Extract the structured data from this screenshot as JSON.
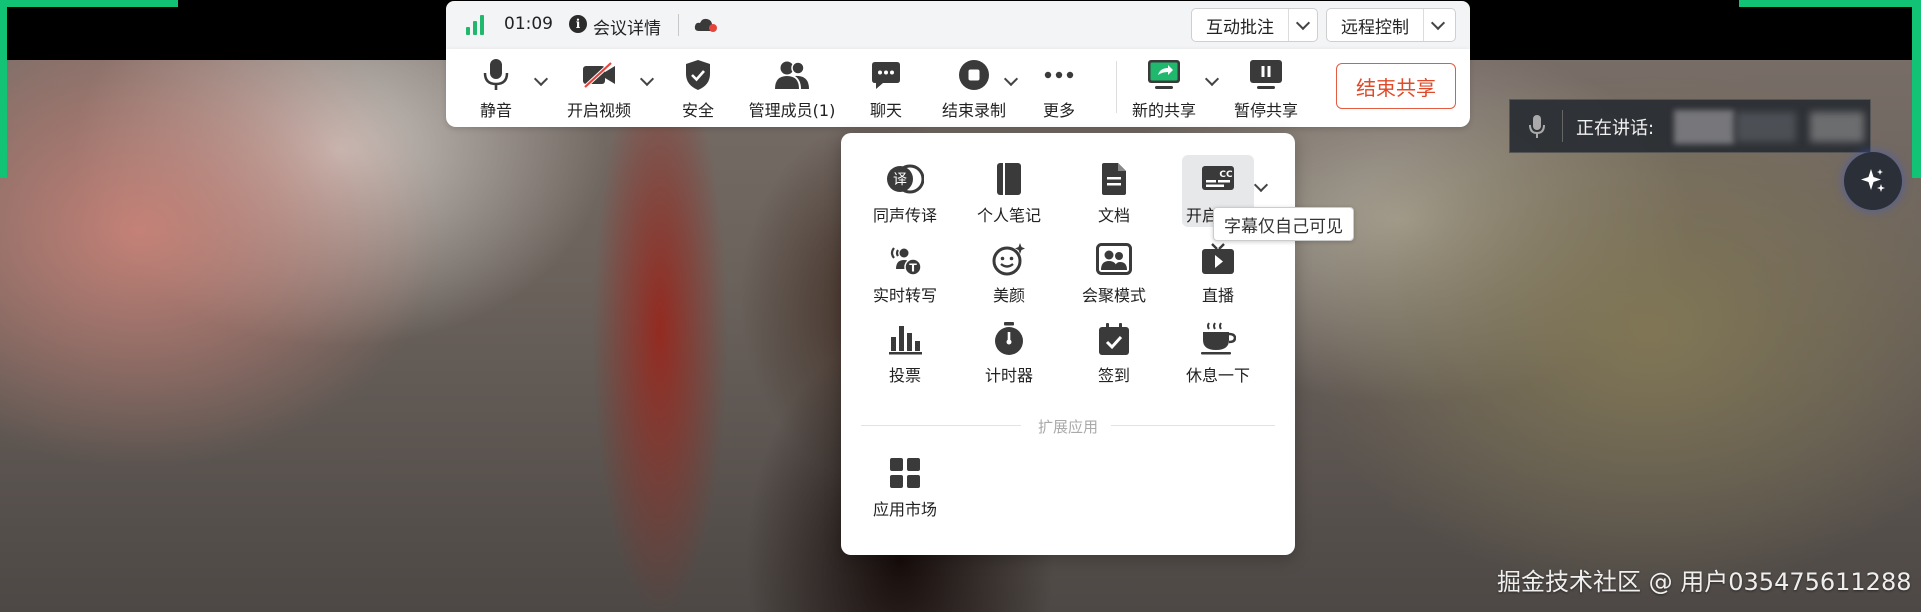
{
  "top_bar": {
    "time": "01:09",
    "meeting_detail_label": "会议详情",
    "annotate_label": "互动批注",
    "remote_control_label": "远程控制"
  },
  "toolbar": {
    "mute_label": "静音",
    "video_label": "开启视频",
    "security_label": "安全",
    "members_label": "管理成员(1)",
    "chat_label": "聊天",
    "record_label": "结束录制",
    "more_label": "更多",
    "new_share_label": "新的共享",
    "pause_share_label": "暂停共享",
    "end_share_label": "结束共享"
  },
  "more_panel": {
    "items": [
      {
        "label": "同声传译",
        "icon": "interpret-icon"
      },
      {
        "label": "个人笔记",
        "icon": "notebook-icon"
      },
      {
        "label": "文档",
        "icon": "document-icon"
      },
      {
        "label": "开启字幕",
        "icon": "captions-icon"
      },
      {
        "label": "实时转写",
        "icon": "transcribe-icon"
      },
      {
        "label": "美颜",
        "icon": "beauty-icon"
      },
      {
        "label": "会聚模式",
        "icon": "together-mode-icon"
      },
      {
        "label": "直播",
        "icon": "live-icon"
      },
      {
        "label": "投票",
        "icon": "poll-icon"
      },
      {
        "label": "计时器",
        "icon": "timer-icon"
      },
      {
        "label": "签到",
        "icon": "checkin-icon"
      },
      {
        "label": "休息一下",
        "icon": "coffee-icon"
      }
    ],
    "section_title": "扩展应用",
    "app_market_label": "应用市场"
  },
  "tooltip": "字幕仅自己可见",
  "speaking": {
    "label": "正在讲话:"
  },
  "watermark": "掘金技术社区 @ 用户035475611288",
  "colors": {
    "accent_green": "#12c275",
    "end_share_red": "#e04a2a",
    "signal_green": "#1fb86c",
    "record_badge": "#e5443a"
  }
}
